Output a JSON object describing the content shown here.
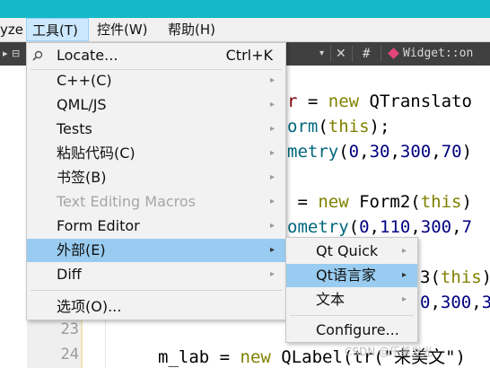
{
  "menubar": {
    "fragment": "yze",
    "tools": "工具(T)",
    "widgets": "控件(W)",
    "help": "帮助(H)"
  },
  "toolbar": {
    "hash": "#",
    "symbol": "Widget::on"
  },
  "code": {
    "line_numbers": [
      "23",
      "24"
    ],
    "lines": [
      {
        "plain_a": "",
        "var": "r",
        "plain_b": " = ",
        "kw": "new",
        "plain_c": " QTranslato"
      },
      {
        "fn": "orm",
        "plain_a": "(",
        "kw": "this",
        "plain_b": ");"
      },
      {
        "fn": "metry",
        "plain_a": "(",
        "n1": "0",
        "c1": ",",
        "n2": "30",
        "c2": ",",
        "n3": "300",
        "c3": ",",
        "n4": "70",
        "c4": ")"
      },
      {
        "plain_a": " = ",
        "kw": "new",
        "plain_b": " Form2(",
        "kw2": "this",
        "plain_c": ")"
      },
      {
        "fn": "ometry",
        "plain_a": "(",
        "n1": "0",
        "c1": ",",
        "n2": "110",
        "c2": ",",
        "n3": "300",
        "c3": ",",
        "n4": "7"
      },
      {
        "plain_a": "3(",
        "kw": "this",
        "plain_b": ")"
      },
      {
        "n1": "0",
        "c1": ",",
        "n2": "300",
        "c2": ",",
        "n3": "3"
      },
      {
        "plain_a": "m_lab = ",
        "kw": "new",
        "plain_b": " QLabel(tr(\"来美文\")"
      }
    ]
  },
  "tools_menu": {
    "items": [
      {
        "label": "Locate...",
        "shortcut": "Ctrl+K"
      },
      {
        "label": "C++(C)"
      },
      {
        "label": "QML/JS"
      },
      {
        "label": "Tests"
      },
      {
        "label": "粘贴代码(C)"
      },
      {
        "label": "书签(B)"
      },
      {
        "label": "Text Editing Macros"
      },
      {
        "label": "Form Editor"
      },
      {
        "label": "外部(E)"
      },
      {
        "label": "Diff"
      },
      {
        "label": "选项(O)..."
      }
    ]
  },
  "external_menu": {
    "items": [
      {
        "label": "Qt Quick"
      },
      {
        "label": "Qt语言家"
      },
      {
        "label": "文本"
      },
      {
        "label": "Configure..."
      }
    ]
  },
  "watermark": "CSDN @乐美发光",
  "colors": {
    "accent_teal": "#15b8c6",
    "highlight": "#99ccf0",
    "menubar_active": "#cce8ff"
  }
}
